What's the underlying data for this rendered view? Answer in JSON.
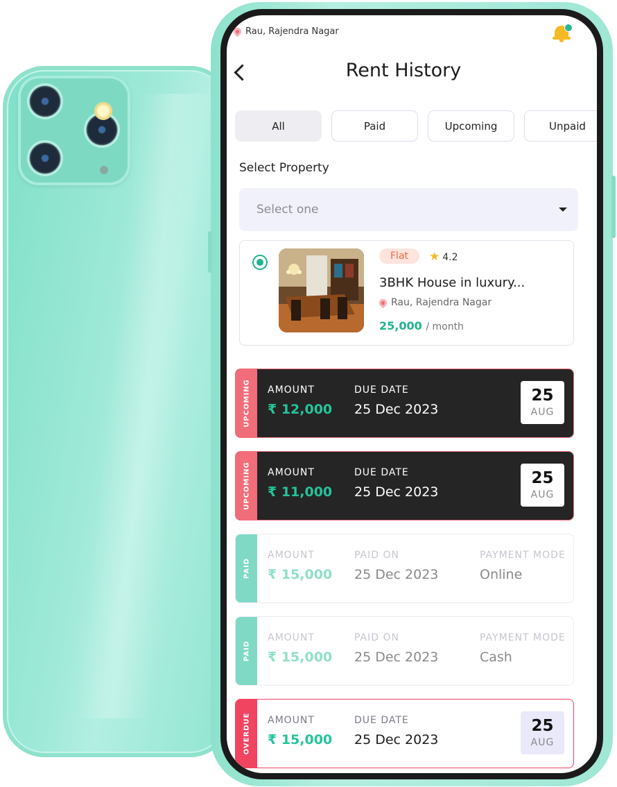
{
  "app": {
    "location": "Rau, Rajendra Nagar",
    "title": "Rent History"
  },
  "tabs": [
    {
      "label": "All",
      "active": true
    },
    {
      "label": "Paid",
      "active": false
    },
    {
      "label": "Upcoming",
      "active": false
    },
    {
      "label": "Unpaid",
      "active": false
    }
  ],
  "select_property": {
    "label": "Select Property",
    "placeholder": "Select one"
  },
  "property": {
    "type": "Flat",
    "rating": "4.2",
    "name": "3BHK House in luxury...",
    "location": "Rau, Rajendra Nagar",
    "price": "25,000",
    "period": "/ month",
    "selected": true
  },
  "rent_entries": [
    {
      "status": "UPCOMING",
      "amount_label": "AMOUNT",
      "amount": "₹ 12,000",
      "date_label": "DUE DATE",
      "date": "25 Dec 2023",
      "day": "25",
      "month": "AUG"
    },
    {
      "status": "UPCOMING",
      "amount_label": "AMOUNT",
      "amount": "₹ 11,000",
      "date_label": "DUE DATE",
      "date": "25 Dec 2023",
      "day": "25",
      "month": "AUG"
    },
    {
      "status": "PAID",
      "amount_label": "AMOUNT",
      "amount": "₹ 15,000",
      "date_label": "PAID ON",
      "date": "25 Dec 2023",
      "mode_label": "PAYMENT MODE",
      "mode": "Online"
    },
    {
      "status": "PAID",
      "amount_label": "AMOUNT",
      "amount": "₹ 15,000",
      "date_label": "PAID ON",
      "date": "25 Dec 2023",
      "mode_label": "PAYMENT MODE",
      "mode": "Cash"
    },
    {
      "status": "OVERDUE",
      "amount_label": "AMOUNT",
      "amount": "₹ 15,000",
      "date_label": "DUE DATE",
      "date": "25 Dec 2023",
      "day": "25",
      "month": "AUG"
    }
  ],
  "colors": {
    "accent": "#20b38f",
    "upcoming": "#f26d7a",
    "paid": "#7fd9c4",
    "overdue": "#f04461",
    "phone_body": "#9fe7d5"
  },
  "icons": [
    "location-pin-icon",
    "bell-icon",
    "back-arrow-icon",
    "chevron-down-icon",
    "star-icon",
    "radio-selected-icon"
  ]
}
